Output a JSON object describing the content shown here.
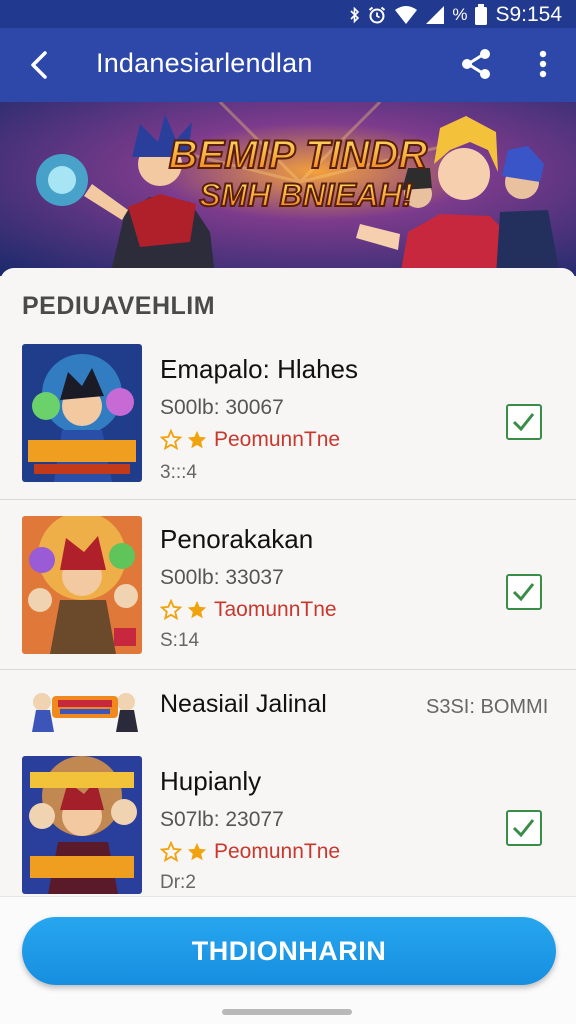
{
  "status_bar": {
    "battery_text": "%",
    "time": "S9:154"
  },
  "app_bar": {
    "title": "Indanesiarlendlan",
    "back_icon": "chevron-left-icon",
    "share_icon": "share-icon",
    "more_icon": "more-vert-icon"
  },
  "banner": {
    "title_line1": "BEMIP TINDR",
    "title_line2": "SMH BNIEAH!"
  },
  "list": {
    "section_title": "PEDIUAVEHLIM",
    "items": [
      {
        "name": "Emapalo: Hlahes",
        "size": "S00lb: 30067",
        "rating_label": "PeomunnTne",
        "meta": "3:::4",
        "checked": true,
        "check_icon": "checkmark-icon"
      },
      {
        "name": "Penorakakan",
        "size": "S00lb: 33037",
        "rating_label": "TaomunnTne",
        "meta": "S:14",
        "checked": true,
        "check_icon": "checkmark-icon"
      },
      {
        "name": "Hupianly",
        "size": "S07lb: 23077",
        "rating_label": "PeomunnTne",
        "meta": "Dr:2",
        "checked": true,
        "check_icon": "checkmark-icon"
      }
    ],
    "mini_item": {
      "name": "Neasiail Jalinal",
      "size": "S3SI: BOMMI"
    }
  },
  "primary_button": {
    "label": "THDIONHARIN"
  },
  "colors": {
    "app_bar": "#2d48a8",
    "status_bar": "#21398f",
    "primary_button": "#1e9be9",
    "check": "#3a8d46",
    "rating_text": "#c8382e",
    "star": "#f0a20f"
  }
}
